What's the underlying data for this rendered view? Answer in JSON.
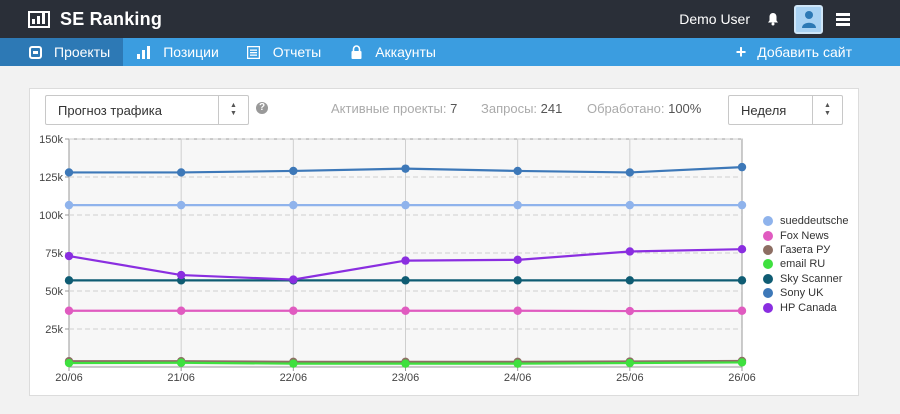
{
  "app": {
    "brand": "SE Ranking",
    "user": "Demo User"
  },
  "icons": {
    "logo": "bar-chart-logo-icon",
    "bell": "bell-icon",
    "avatar": "user-avatar-icon",
    "menu": "hamburger-menu-icon"
  },
  "nav": {
    "items": [
      {
        "label": "Проекты",
        "icon": "projects-icon",
        "active": true
      },
      {
        "label": "Позиции",
        "icon": "positions-bar-icon",
        "active": false
      },
      {
        "label": "Отчеты",
        "icon": "reports-list-icon",
        "active": false
      },
      {
        "label": "Аккаунты",
        "icon": "lock-icon",
        "active": false
      }
    ],
    "add_site": "Добавить сайт"
  },
  "toolbar": {
    "forecast_select": "Прогноз трафика",
    "stats": [
      {
        "label": "Активные проекты:",
        "value": "7"
      },
      {
        "label": "Запросы:",
        "value": "241"
      },
      {
        "label": "Обработано:",
        "value": "100%"
      }
    ],
    "period_select": "Неделя"
  },
  "colors": {
    "topbar": "#2a2f38",
    "navbar": "#3b9de0",
    "nav_active": "#2d79b5"
  },
  "chart_data": {
    "type": "line",
    "x": [
      "20/06",
      "21/06",
      "22/06",
      "23/06",
      "24/06",
      "25/06",
      "26/06"
    ],
    "ylim": [
      0,
      150000
    ],
    "yticks": [
      "25k",
      "50k",
      "75k",
      "100k",
      "125k",
      "150k"
    ],
    "ytick_values": [
      25000,
      50000,
      75000,
      100000,
      125000,
      150000
    ],
    "grid": true,
    "legend_position": "right",
    "series": [
      {
        "name": "sueddeutsche",
        "color": "#8fb3ec",
        "values": [
          106500,
          106500,
          106500,
          106500,
          106500,
          106500,
          106500
        ]
      },
      {
        "name": "Fox News",
        "color": "#e05bc0",
        "values": [
          37000,
          37000,
          37000,
          37000,
          37000,
          36800,
          37000
        ]
      },
      {
        "name": "Газета РУ",
        "color": "#8d6e63",
        "values": [
          3800,
          3800,
          3400,
          3400,
          3400,
          3600,
          4000
        ]
      },
      {
        "name": "email RU",
        "color": "#3fe03f",
        "values": [
          2600,
          2800,
          2200,
          2200,
          2200,
          2600,
          3000
        ]
      },
      {
        "name": "Sky Scanner",
        "color": "#0f5c73",
        "values": [
          57000,
          57000,
          57000,
          57000,
          57000,
          57000,
          57000
        ]
      },
      {
        "name": "Sony UK",
        "color": "#3d78b8",
        "values": [
          128000,
          128000,
          129000,
          130500,
          129000,
          128000,
          131500
        ]
      },
      {
        "name": "HP Canada",
        "color": "#8a2ee0",
        "values": [
          73000,
          60500,
          57500,
          70000,
          70500,
          76000,
          77500
        ]
      }
    ]
  }
}
